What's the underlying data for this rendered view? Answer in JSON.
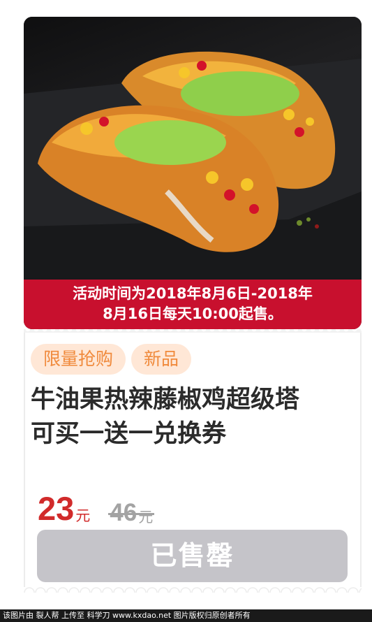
{
  "product": {
    "notice_line1": "活动时间为2018年8月6日-2018年",
    "notice_line2": "8月16日每天10:00起售。",
    "tags": [
      "限量抢购",
      "新品"
    ],
    "title_line1": "牛油果热辣藤椒鸡超级塔",
    "title_line2": "可买一送一兑换券",
    "price": "23",
    "price_unit": "元",
    "original_price": "46",
    "original_unit": "元",
    "button_label": "已售罄"
  },
  "watermark": "该图片由 裂人帮 上传至 科学刀 www.kxdao.net 图片版权归原创者所有",
  "colors": {
    "notice_bg": "#c8102e",
    "price": "#d12b2b",
    "tag_bg": "#ffe7d6",
    "tag_text": "#f08a3c",
    "disabled_button": "#c5c4c9"
  }
}
